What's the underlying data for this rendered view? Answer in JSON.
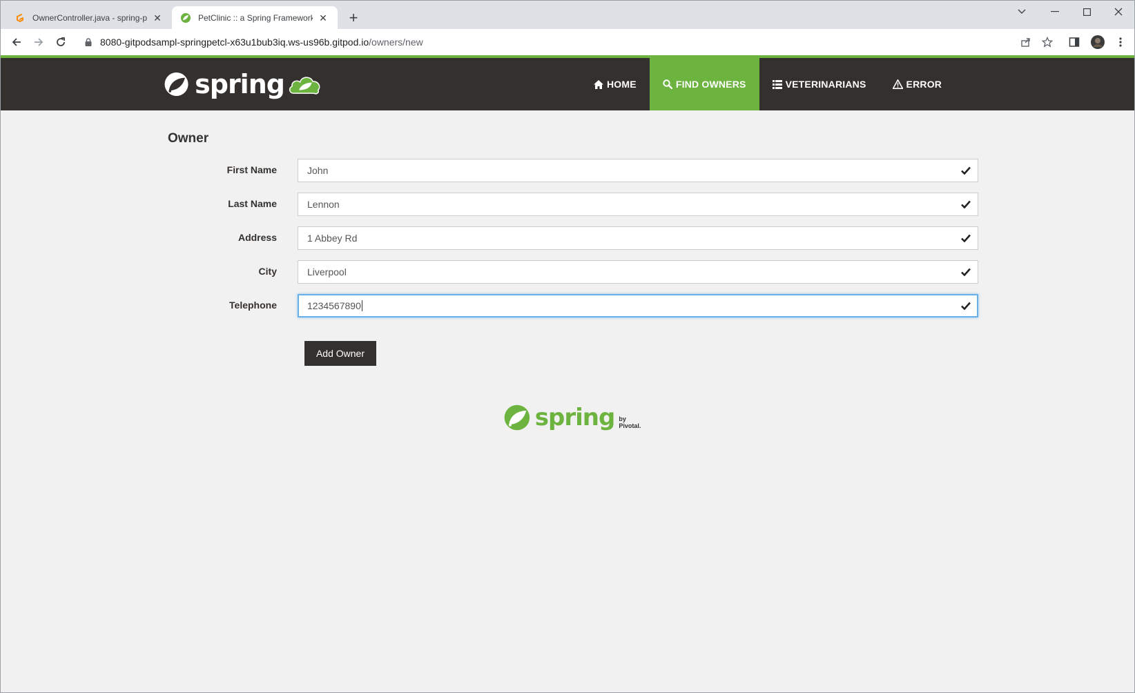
{
  "browser": {
    "tabs": [
      {
        "title": "OwnerController.java - spring-pe",
        "icon": "gitpod-icon",
        "active": false
      },
      {
        "title": "PetClinic :: a Spring Framework d",
        "icon": "spring-leaf-icon",
        "active": true
      }
    ],
    "new_tab_label": "+",
    "url_host": "8080-gitpodsampl-springpetcl-x63u1bub3iq.ws-us96b.gitpod.io",
    "url_path": "/owners/new"
  },
  "navbar": {
    "brand": "spring",
    "items": [
      {
        "label": "HOME",
        "icon": "home-icon",
        "active": false
      },
      {
        "label": "FIND OWNERS",
        "icon": "search-icon",
        "active": true
      },
      {
        "label": "VETERINARIANS",
        "icon": "list-icon",
        "active": false
      },
      {
        "label": "ERROR",
        "icon": "warning-icon",
        "active": false
      }
    ]
  },
  "form": {
    "heading": "Owner",
    "fields": [
      {
        "label": "First Name",
        "value": "John"
      },
      {
        "label": "Last Name",
        "value": "Lennon"
      },
      {
        "label": "Address",
        "value": "1 Abbey Rd"
      },
      {
        "label": "City",
        "value": "Liverpool"
      },
      {
        "label": "Telephone",
        "value": "1234567890"
      }
    ],
    "submit_label": "Add Owner"
  },
  "footer": {
    "brand": "spring",
    "by": "by Pivotal."
  },
  "colors": {
    "accent": "#6db33f",
    "navbar": "#34302d",
    "background": "#f1f1f1"
  }
}
